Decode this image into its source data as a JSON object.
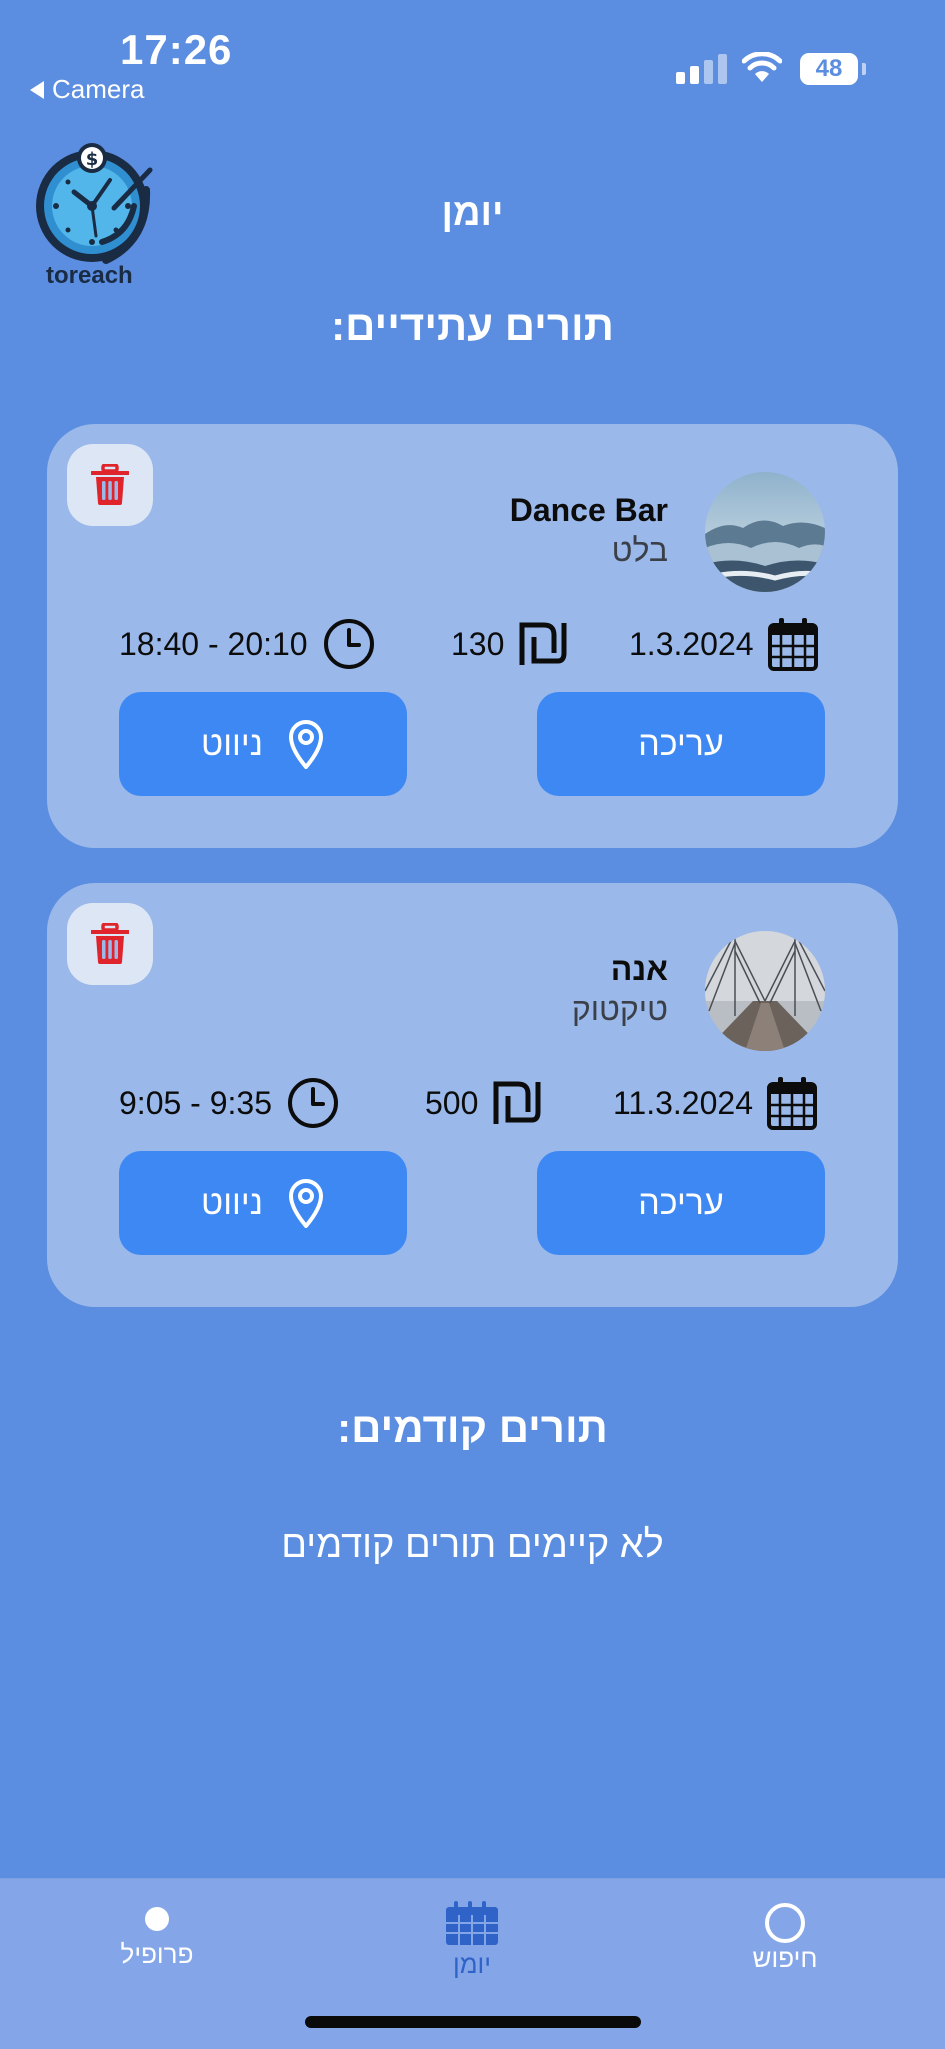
{
  "status_bar": {
    "time": "17:26",
    "back_label": "Camera",
    "battery": "48"
  },
  "logo": {
    "text": "toreach"
  },
  "header": {
    "title": "יומן"
  },
  "upcoming": {
    "title": "תורים עתידיים:",
    "appointments": [
      {
        "name": "Dance Bar",
        "service": "בלט",
        "date": "1.3.2024",
        "price": "130",
        "time_range": "18:40 - 20:10",
        "edit_label": "עריכה",
        "navigate_label": "ניווט"
      },
      {
        "name": "אנה",
        "service": "טיקטוק",
        "date": "11.3.2024",
        "price": "500",
        "time_range": "9:05 - 9:35",
        "edit_label": "עריכה",
        "navigate_label": "ניווט"
      }
    ]
  },
  "past": {
    "title": "תורים קודמים:",
    "empty_message": "לא קיימים תורים קודמים"
  },
  "tabbar": {
    "items": [
      {
        "label": "פרופיל",
        "icon": "profile-dot-icon"
      },
      {
        "label": "יומן",
        "icon": "calendar-icon",
        "active": true
      },
      {
        "label": "חיפוש",
        "icon": "search-icon"
      }
    ]
  },
  "colors": {
    "background": "#5b8de0",
    "card": "#9ab8ea",
    "button": "#3e88f4",
    "trash": "#e0242b",
    "tab_active": "#2f63c8"
  }
}
